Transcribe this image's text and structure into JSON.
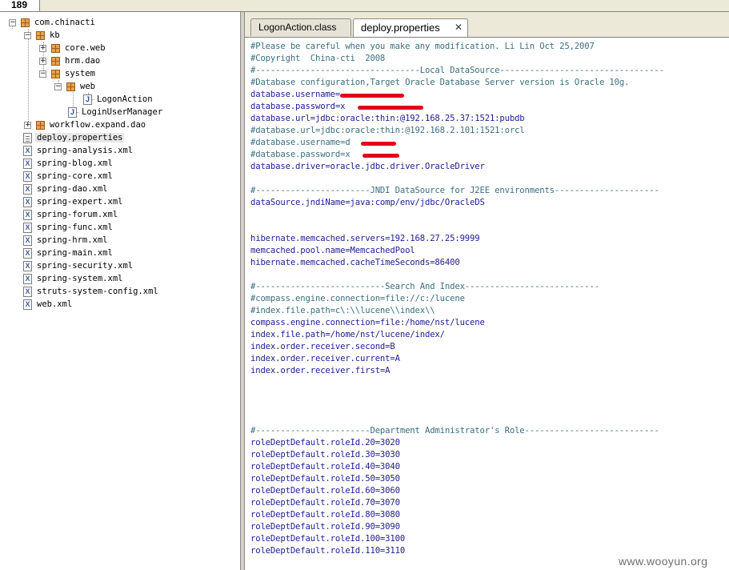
{
  "top_tab": {
    "label": "189"
  },
  "tree": {
    "items": [
      {
        "label": "com.chinacti"
      },
      {
        "label": "kb"
      },
      {
        "label": "core.web"
      },
      {
        "label": "hrm.dao"
      },
      {
        "label": "system"
      },
      {
        "label": "web"
      },
      {
        "label": "LogonAction"
      },
      {
        "label": "LoginUserManager"
      },
      {
        "label": "workflow.expand.dao"
      },
      {
        "label": "deploy.properties"
      },
      {
        "label": "spring-analysis.xml"
      },
      {
        "label": "spring-blog.xml"
      },
      {
        "label": "spring-core.xml"
      },
      {
        "label": "spring-dao.xml"
      },
      {
        "label": "spring-expert.xml"
      },
      {
        "label": "spring-forum.xml"
      },
      {
        "label": "spring-func.xml"
      },
      {
        "label": "spring-hrm.xml"
      },
      {
        "label": "spring-main.xml"
      },
      {
        "label": "spring-security.xml"
      },
      {
        "label": "spring-system.xml"
      },
      {
        "label": "struts-system-config.xml"
      },
      {
        "label": "web.xml"
      }
    ]
  },
  "editor": {
    "tabs": [
      {
        "label": "LogonAction.class"
      },
      {
        "label": "deploy.properties",
        "close": "✕"
      }
    ],
    "lines": [
      "#Please be careful when you make any modification. Li Lin Oct 25,2007",
      "#Copyright  China-cti  2008",
      "#---------------------------------Local DataSource---------------------------------",
      "#Database configuration,Target Oracle Database Server version is Oracle 10g.",
      "database.username=",
      "database.password=x",
      "database.url=jdbc:oracle:thin:@192.168.25.37:1521:pubdb",
      "#database.url=jdbc:oracle:thin:@192.168.2.101:1521:orcl",
      "#database.username=d",
      "#database.password=x",
      "database.driver=oracle.jdbc.driver.OracleDriver",
      "",
      "#-----------------------JNDI DataSource for J2EE environments---------------------",
      "dataSource.jndiName=java:comp/env/jdbc/OracleDS",
      "",
      "",
      "hibernate.memcached.servers=192.168.27.25:9999",
      "memcached.pool.name=MemcachedPool",
      "hibernate.memcached.cacheTimeSeconds=86400",
      "",
      "#--------------------------Search And Index---------------------------",
      "#compass.engine.connection=file://c:/lucene",
      "#index.file.path=c\\:\\\\lucene\\\\index\\\\",
      "compass.engine.connection=file:/home/nst/lucene",
      "index.file.path=/home/nst/lucene/index/",
      "index.order.receiver.second=B",
      "index.order.receiver.current=A",
      "index.order.receiver.first=A",
      "",
      "",
      "",
      "",
      "#-----------------------Department Administrator's Role---------------------------",
      "roleDeptDefault.roleId.20=3020",
      "roleDeptDefault.roleId.30=3030",
      "roleDeptDefault.roleId.40=3040",
      "roleDeptDefault.roleId.50=3050",
      "roleDeptDefault.roleId.60=3060",
      "roleDeptDefault.roleId.70=3070",
      "roleDeptDefault.roleId.80=3080",
      "roleDeptDefault.roleId.90=3090",
      "roleDeptDefault.roleId.100=3100",
      "roleDeptDefault.roleId.110=3110"
    ]
  },
  "watermark": "www.wooyun.org"
}
